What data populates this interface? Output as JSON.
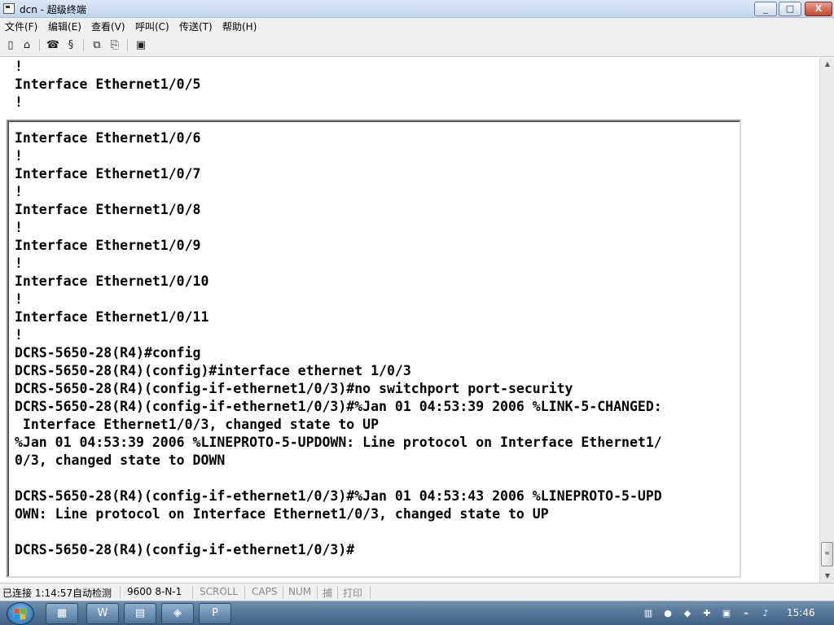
{
  "window": {
    "title": "dcn - 超级终端",
    "minimize_label": "_",
    "maximize_label": "□",
    "close_label": "X"
  },
  "menu": [
    "文件(F)",
    "编辑(E)",
    "查看(V)",
    "呼叫(C)",
    "传送(T)",
    "帮助(H)"
  ],
  "toolbar_icons": [
    "new-file-icon",
    "open-folder-icon",
    "connect-icon",
    "disconnect-icon",
    "send-icon",
    "receive-icon",
    "properties-icon"
  ],
  "terminal": {
    "previous_lines": [
      "!",
      "Interface Ethernet1/0/5",
      "!"
    ],
    "current_lines": [
      "Interface Ethernet1/0/6",
      "!",
      "Interface Ethernet1/0/7",
      "!",
      "Interface Ethernet1/0/8",
      "!",
      "Interface Ethernet1/0/9",
      "!",
      "Interface Ethernet1/0/10",
      "!",
      "Interface Ethernet1/0/11",
      "!",
      "DCRS-5650-28(R4)#config",
      "DCRS-5650-28(R4)(config)#interface ethernet 1/0/3",
      "DCRS-5650-28(R4)(config-if-ethernet1/0/3)#no switchport port-security",
      "DCRS-5650-28(R4)(config-if-ethernet1/0/3)#%Jan 01 04:53:39 2006 %LINK-5-CHANGED:",
      " Interface Ethernet1/0/3, changed state to UP",
      "%Jan 01 04:53:39 2006 %LINEPROTO-5-UPDOWN: Line protocol on Interface Ethernet1/",
      "0/3, changed state to DOWN",
      "",
      "DCRS-5650-28(R4)(config-if-ethernet1/0/3)#%Jan 01 04:53:43 2006 %LINEPROTO-5-UPD",
      "OWN: Line protocol on Interface Ethernet1/0/3, changed state to UP",
      "",
      "DCRS-5650-28(R4)(config-if-ethernet1/0/3)#"
    ]
  },
  "status": {
    "connection": "已连接 1:14:57",
    "detect": "自动检测",
    "settings": "9600 8-N-1",
    "scroll": "SCROLL",
    "caps": "CAPS",
    "num": "NUM",
    "capture": "捕",
    "print": "打印"
  },
  "taskbar": {
    "clock": "15:46"
  },
  "colors": {
    "terminal_bg": "#ffffff",
    "terminal_text": "#000000",
    "taskbar": "#4a6c90"
  }
}
